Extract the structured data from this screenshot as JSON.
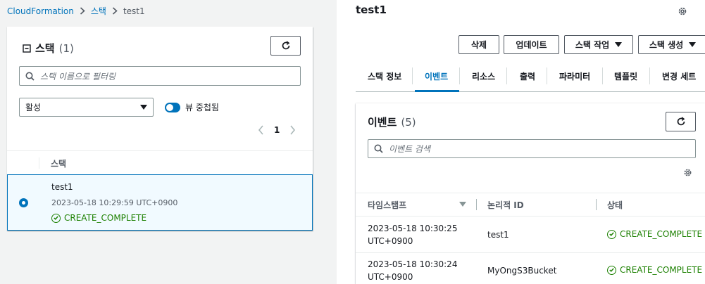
{
  "breadcrumb": {
    "root": "CloudFormation",
    "stacks": "스택",
    "current": "test1"
  },
  "left_panel": {
    "title": "스택",
    "count": "(1)",
    "search_placeholder": "스택 이름으로 필터링",
    "filter_value": "활성",
    "nested_toggle_label": "뷰 중첩됨",
    "page_number": "1",
    "column_header": "스택",
    "stacks": [
      {
        "name": "test1",
        "date": "2023-05-18 10:29:59 UTC+0900",
        "status": "CREATE_COMPLETE"
      }
    ]
  },
  "right_panel": {
    "title": "test1",
    "buttons": {
      "delete": "삭제",
      "update": "업데이트",
      "stack_actions": "스택 작업",
      "create_stack": "스택 생성"
    },
    "tabs": [
      "스택 정보",
      "이벤트",
      "리소스",
      "출력",
      "파라미터",
      "템플릿",
      "변경 세트"
    ],
    "active_tab": "이벤트",
    "events": {
      "title": "이벤트",
      "count": "(5)",
      "search_placeholder": "이벤트 검색",
      "columns": [
        "타임스탬프",
        "논리적 ID",
        "상태"
      ],
      "rows": [
        {
          "timestamp_line1": "2023-05-18 10:30:25",
          "timestamp_line2": "UTC+0900",
          "logical_id": "test1",
          "status": "CREATE_COMPLETE"
        },
        {
          "timestamp_line1": "2023-05-18 10:30:24",
          "timestamp_line2": "UTC+0900",
          "logical_id": "MyOngS3Bucket",
          "status": "CREATE_COMPLETE"
        }
      ]
    }
  },
  "colors": {
    "link": "#0073bb",
    "success": "#1d8102",
    "selected_bg": "#f1faff",
    "selected_border": "#0073bb"
  }
}
